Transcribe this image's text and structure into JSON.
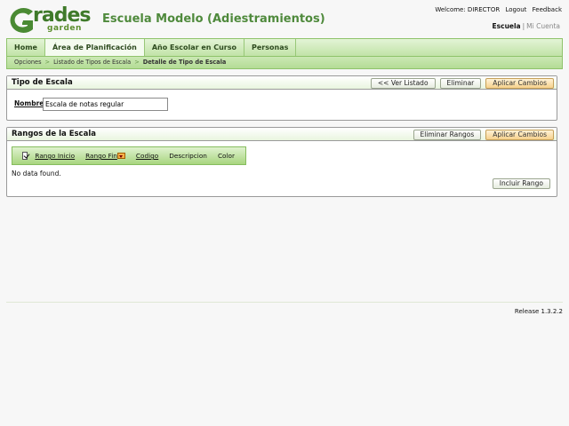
{
  "logo": {
    "word": "rades",
    "sub": "garden",
    "icon": "grades-garden-logo-icon"
  },
  "header": {
    "school_title": "Escuela Modelo (Adiestramientos)",
    "welcome": "Welcome: DIRECTOR",
    "logout": "Logout",
    "feedback": "Feedback",
    "school_link": "Escuela",
    "account_link": "Mi Cuenta"
  },
  "tabs": [
    {
      "label": "Home"
    },
    {
      "label": "Área de Planificación"
    },
    {
      "label": "Año Escolar en Curso"
    },
    {
      "label": "Personas"
    }
  ],
  "breadcrumb": [
    "Opciones",
    "Listado de Tipos de Escala",
    "Detalle de Tipo de Escala"
  ],
  "tipo_panel": {
    "title": "Tipo de Escala",
    "btn_list": "<< Ver Listado",
    "btn_delete": "Eliminar",
    "btn_apply": "Aplicar Cambios",
    "field_label": "Nombre",
    "field_value": "Escala de notas regular"
  },
  "rangos_panel": {
    "title": "Rangos de la Escala",
    "btn_delete": "Eliminar Rangos",
    "btn_apply": "Aplicar Cambios",
    "columns": [
      "Rango Inicio",
      "Rango Fin",
      "Codigo",
      "Descripcion",
      "Color"
    ],
    "empty_text": "No data found.",
    "btn_add": "Incluir Rango"
  },
  "footer": {
    "release": "Release 1.3.2.2"
  },
  "colors": {
    "accent_green": "#4f8a3c",
    "tab_green": "#c1e3a7",
    "primary_button": "#f6d18c"
  }
}
